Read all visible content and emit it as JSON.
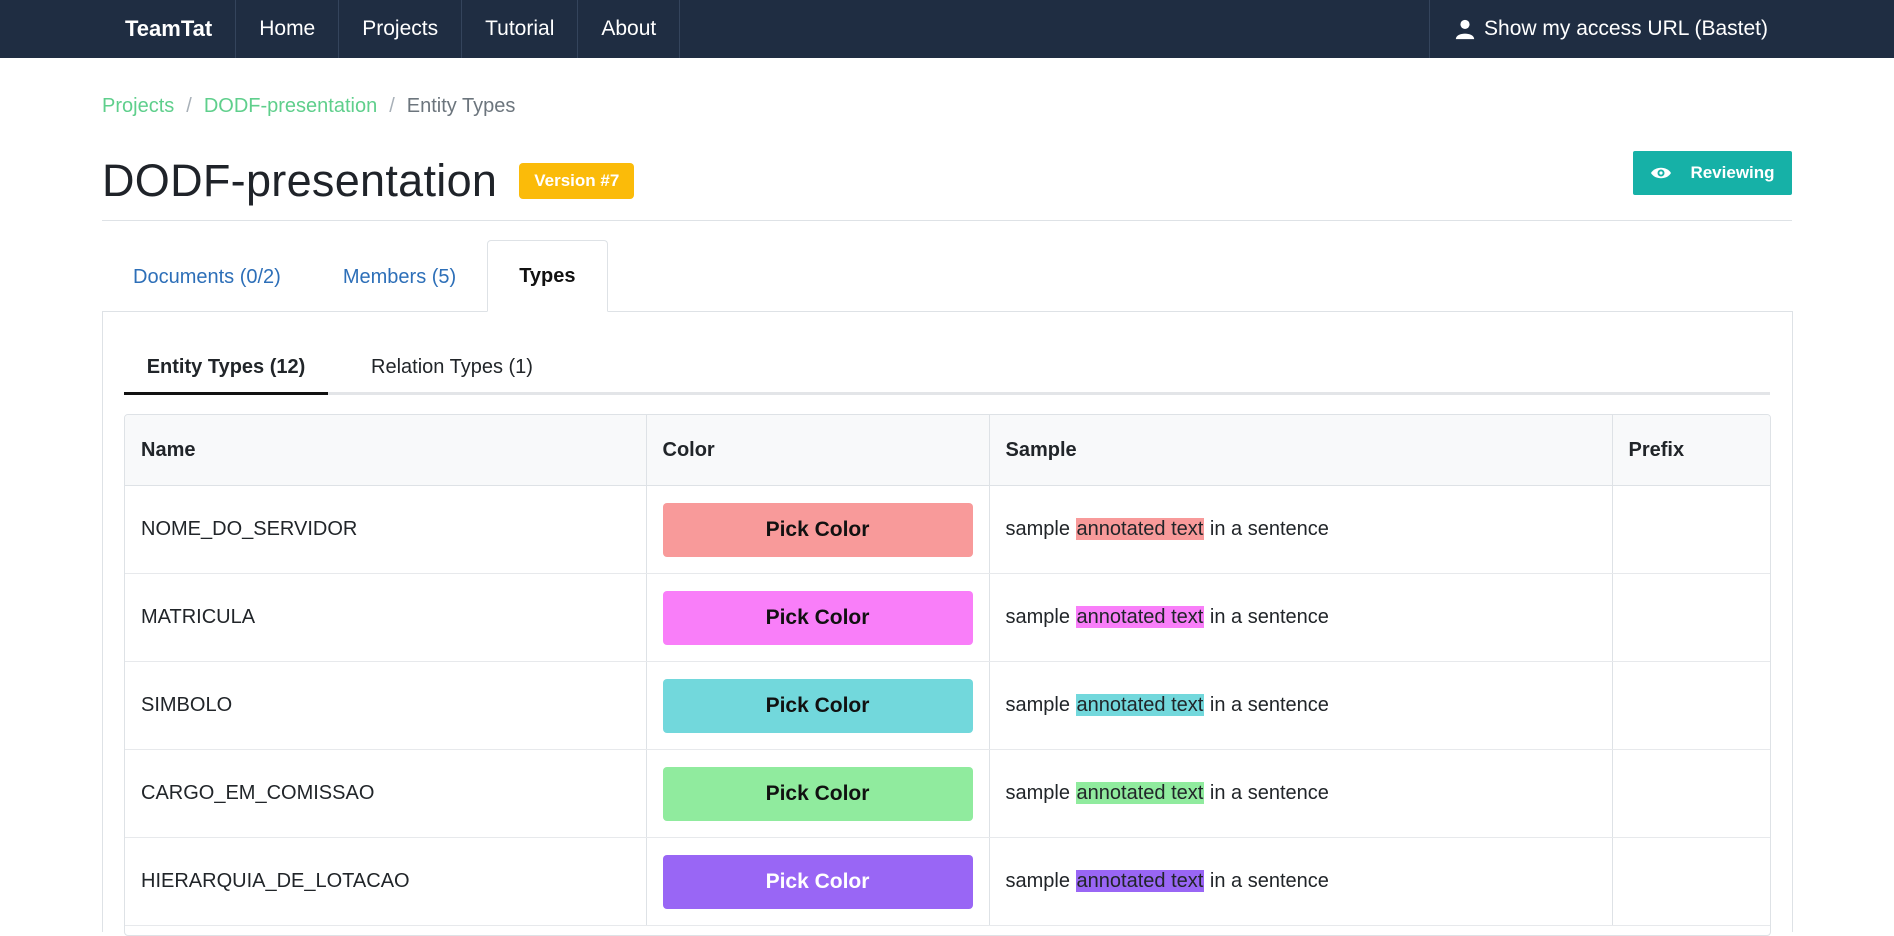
{
  "navbar": {
    "brand": "TeamTat",
    "items": [
      "Home",
      "Projects",
      "Tutorial",
      "About"
    ],
    "access_url_label": "Show my access URL (Bastet)"
  },
  "breadcrumb": {
    "items": [
      "Projects",
      "DODF-presentation"
    ],
    "current": "Entity Types",
    "separator": "/"
  },
  "header": {
    "title": "DODF-presentation",
    "version_badge": "Version #7",
    "reviewing_label": "Reviewing"
  },
  "tabs": [
    {
      "label": "Documents (0/2)"
    },
    {
      "label": "Members (5)"
    },
    {
      "label": "Types"
    }
  ],
  "subtabs": [
    {
      "label": "Entity Types (12)"
    },
    {
      "label": "Relation Types (1)"
    }
  ],
  "table": {
    "headers": [
      "Name",
      "Color",
      "Sample",
      "Prefix"
    ],
    "pick_label": "Pick Color",
    "sample_before": "sample",
    "sample_highlight": "annotated text",
    "sample_after": "in a sentence",
    "rows": [
      {
        "name": "NOME_DO_SERVIDOR",
        "color": "#f89a9a",
        "prefix": ""
      },
      {
        "name": "MATRICULA",
        "color": "#f97ef9",
        "prefix": ""
      },
      {
        "name": "SIMBOLO",
        "color": "#72d8dc",
        "prefix": ""
      },
      {
        "name": "CARGO_EM_COMISSAO",
        "color": "#90eb9e",
        "prefix": ""
      },
      {
        "name": "HIERARQUIA_DE_LOTACAO",
        "color": "#9966f5",
        "prefix": ""
      }
    ]
  },
  "colors": {
    "navbar_bg": "#1f2d42",
    "accent_green": "#5fcf8c",
    "badge_yellow": "#fbbb09",
    "reviewing_teal": "#16b1a7",
    "tab_link_blue": "#2d6fb8"
  }
}
